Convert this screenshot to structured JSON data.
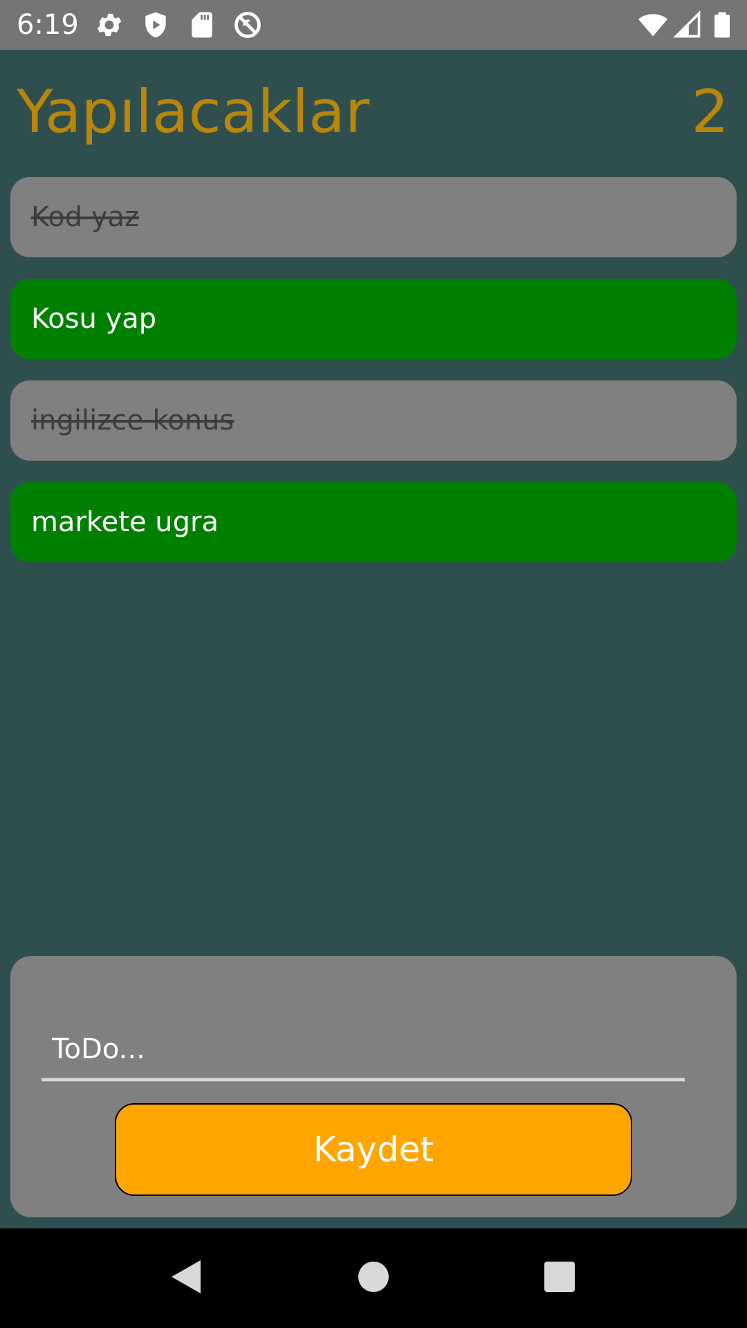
{
  "status_bar": {
    "time": "6:19",
    "left_icons": [
      "gear-icon",
      "play-protect-icon",
      "sd-card-icon",
      "do-not-disturb-icon"
    ],
    "right_icons": [
      "wifi-icon",
      "signal-icon",
      "battery-icon"
    ]
  },
  "header": {
    "title": "Yapılacaklar",
    "count": "2"
  },
  "todos": [
    {
      "text": "Kod yaz",
      "done": true
    },
    {
      "text": "Kosu yap",
      "done": false
    },
    {
      "text": "ingilizce konus",
      "done": true
    },
    {
      "text": "markete ugra",
      "done": false
    }
  ],
  "input_card": {
    "placeholder": "ToDo...",
    "value": "",
    "save_label": "Kaydet"
  },
  "nav_bar": {
    "buttons": [
      "back-icon",
      "home-icon",
      "recents-icon"
    ]
  },
  "colors": {
    "background": "#2f4f4f",
    "title": "#b8860b",
    "done_item": "#808080",
    "pending_item": "#008000",
    "save_button": "#ffa500"
  }
}
